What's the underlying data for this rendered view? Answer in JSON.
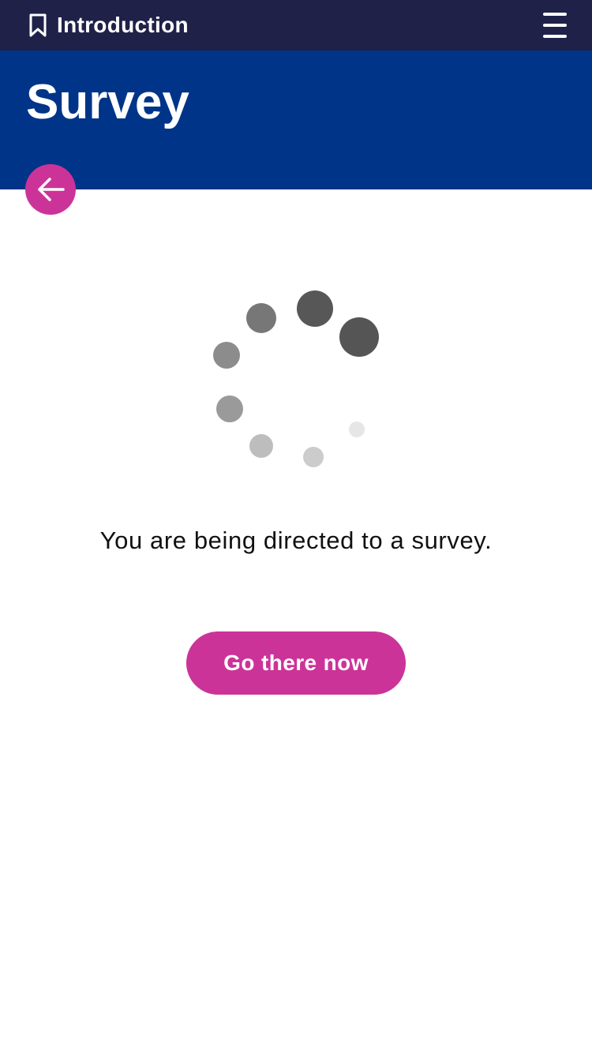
{
  "header": {
    "title": "Introduction",
    "bookmark_icon": "bookmark-icon",
    "menu_icon": "hamburger-menu-icon",
    "background": "#1f2148"
  },
  "hero": {
    "title": "Survey",
    "background": "#003489"
  },
  "back_button": {
    "icon": "arrow-left-icon",
    "color": "#cc3399"
  },
  "loading": {
    "icon": "loading-spinner-icon"
  },
  "main": {
    "message": "You are being directed to a survey.",
    "cta_label": "Go there now",
    "cta_color": "#cc3399"
  }
}
